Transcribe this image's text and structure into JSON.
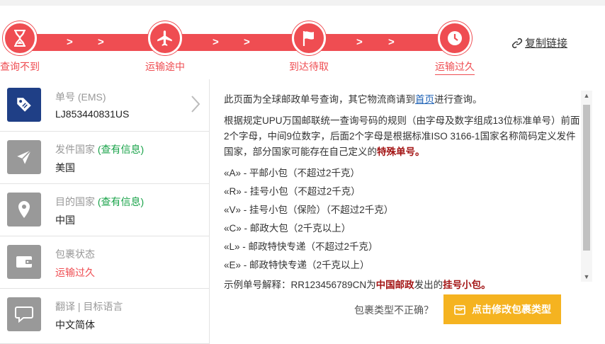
{
  "progress": {
    "steps": [
      {
        "label": "查询不到",
        "icon": "hourglass-icon"
      },
      {
        "label": "运输途中",
        "icon": "airplane-icon"
      },
      {
        "label": "到达待取",
        "icon": "flag-icon"
      },
      {
        "label": "运输过久",
        "icon": "clock-icon"
      }
    ],
    "active_step": "运输过久",
    "accent_color": "#ef4d52"
  },
  "copy_link": {
    "label": "复制链接",
    "icon": "link-icon"
  },
  "info": {
    "tracking": {
      "title": "单号 (EMS)",
      "value": "LJ853440831US",
      "icon": "tag-icon"
    },
    "origin": {
      "title": "发件国家",
      "check": "(查有信息)",
      "value": "美国",
      "icon": "send-icon"
    },
    "destination": {
      "title": "目的国家",
      "check": "(查有信息)",
      "value": "中国",
      "icon": "location-pin-icon"
    },
    "status": {
      "title": "包裹状态",
      "value": "运输过久",
      "icon": "wallet-icon"
    },
    "translate": {
      "title": "翻译 | 目标语言",
      "value": "中文简体",
      "icon": "speech-bubble-icon"
    }
  },
  "explain": {
    "p1_a": "此页面为全球邮政单号查询，其它物流商请到",
    "p1_link": "首页",
    "p1_b": "进行查询。",
    "p2_a": "根据规定UPU万国邮联统一查询号码的规则（由字母及数字组成13位标准单号）前面2个字母，中间9位数字，后面2个字母是根据标准ISO 3166-1国家名称简码定义发件国家，部分国家可能存在自己定义的",
    "p2_bold": "特殊单号。",
    "rules": [
      "«A» - 平邮小包（不超过2千克）",
      "«R» - 挂号小包（不超过2千克）",
      "«V» - 挂号小包（保险）（不超过2千克）",
      "«C» - 邮政大包（2千克以上）",
      "«L» - 邮政特快专递（不超过2千克）",
      "«E» - 邮政特快专递（2千克以上）"
    ],
    "example_a": "示例单号解释：RR123456789CN为",
    "example_b1": "中国邮政",
    "example_c": "发出的",
    "example_b2": "挂号小包。"
  },
  "bottom": {
    "question": "包裹类型不正确？",
    "button": "点击修改包裹类型",
    "button_icon": "package-icon",
    "button_color": "#f5b320"
  }
}
